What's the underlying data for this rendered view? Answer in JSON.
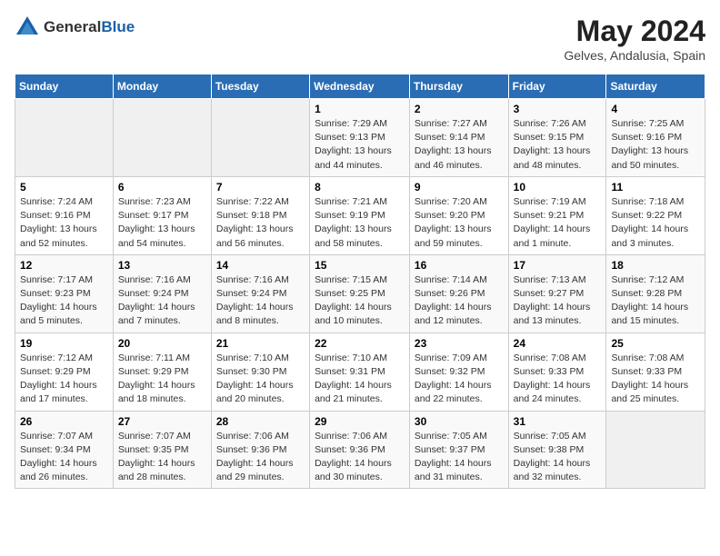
{
  "header": {
    "logo_general": "General",
    "logo_blue": "Blue",
    "month": "May 2024",
    "location": "Gelves, Andalusia, Spain"
  },
  "weekdays": [
    "Sunday",
    "Monday",
    "Tuesday",
    "Wednesday",
    "Thursday",
    "Friday",
    "Saturday"
  ],
  "weeks": [
    [
      {
        "day": "",
        "info": ""
      },
      {
        "day": "",
        "info": ""
      },
      {
        "day": "",
        "info": ""
      },
      {
        "day": "1",
        "info": "Sunrise: 7:29 AM\nSunset: 9:13 PM\nDaylight: 13 hours\nand 44 minutes."
      },
      {
        "day": "2",
        "info": "Sunrise: 7:27 AM\nSunset: 9:14 PM\nDaylight: 13 hours\nand 46 minutes."
      },
      {
        "day": "3",
        "info": "Sunrise: 7:26 AM\nSunset: 9:15 PM\nDaylight: 13 hours\nand 48 minutes."
      },
      {
        "day": "4",
        "info": "Sunrise: 7:25 AM\nSunset: 9:16 PM\nDaylight: 13 hours\nand 50 minutes."
      }
    ],
    [
      {
        "day": "5",
        "info": "Sunrise: 7:24 AM\nSunset: 9:16 PM\nDaylight: 13 hours\nand 52 minutes."
      },
      {
        "day": "6",
        "info": "Sunrise: 7:23 AM\nSunset: 9:17 PM\nDaylight: 13 hours\nand 54 minutes."
      },
      {
        "day": "7",
        "info": "Sunrise: 7:22 AM\nSunset: 9:18 PM\nDaylight: 13 hours\nand 56 minutes."
      },
      {
        "day": "8",
        "info": "Sunrise: 7:21 AM\nSunset: 9:19 PM\nDaylight: 13 hours\nand 58 minutes."
      },
      {
        "day": "9",
        "info": "Sunrise: 7:20 AM\nSunset: 9:20 PM\nDaylight: 13 hours\nand 59 minutes."
      },
      {
        "day": "10",
        "info": "Sunrise: 7:19 AM\nSunset: 9:21 PM\nDaylight: 14 hours\nand 1 minute."
      },
      {
        "day": "11",
        "info": "Sunrise: 7:18 AM\nSunset: 9:22 PM\nDaylight: 14 hours\nand 3 minutes."
      }
    ],
    [
      {
        "day": "12",
        "info": "Sunrise: 7:17 AM\nSunset: 9:23 PM\nDaylight: 14 hours\nand 5 minutes."
      },
      {
        "day": "13",
        "info": "Sunrise: 7:16 AM\nSunset: 9:24 PM\nDaylight: 14 hours\nand 7 minutes."
      },
      {
        "day": "14",
        "info": "Sunrise: 7:16 AM\nSunset: 9:24 PM\nDaylight: 14 hours\nand 8 minutes."
      },
      {
        "day": "15",
        "info": "Sunrise: 7:15 AM\nSunset: 9:25 PM\nDaylight: 14 hours\nand 10 minutes."
      },
      {
        "day": "16",
        "info": "Sunrise: 7:14 AM\nSunset: 9:26 PM\nDaylight: 14 hours\nand 12 minutes."
      },
      {
        "day": "17",
        "info": "Sunrise: 7:13 AM\nSunset: 9:27 PM\nDaylight: 14 hours\nand 13 minutes."
      },
      {
        "day": "18",
        "info": "Sunrise: 7:12 AM\nSunset: 9:28 PM\nDaylight: 14 hours\nand 15 minutes."
      }
    ],
    [
      {
        "day": "19",
        "info": "Sunrise: 7:12 AM\nSunset: 9:29 PM\nDaylight: 14 hours\nand 17 minutes."
      },
      {
        "day": "20",
        "info": "Sunrise: 7:11 AM\nSunset: 9:29 PM\nDaylight: 14 hours\nand 18 minutes."
      },
      {
        "day": "21",
        "info": "Sunrise: 7:10 AM\nSunset: 9:30 PM\nDaylight: 14 hours\nand 20 minutes."
      },
      {
        "day": "22",
        "info": "Sunrise: 7:10 AM\nSunset: 9:31 PM\nDaylight: 14 hours\nand 21 minutes."
      },
      {
        "day": "23",
        "info": "Sunrise: 7:09 AM\nSunset: 9:32 PM\nDaylight: 14 hours\nand 22 minutes."
      },
      {
        "day": "24",
        "info": "Sunrise: 7:08 AM\nSunset: 9:33 PM\nDaylight: 14 hours\nand 24 minutes."
      },
      {
        "day": "25",
        "info": "Sunrise: 7:08 AM\nSunset: 9:33 PM\nDaylight: 14 hours\nand 25 minutes."
      }
    ],
    [
      {
        "day": "26",
        "info": "Sunrise: 7:07 AM\nSunset: 9:34 PM\nDaylight: 14 hours\nand 26 minutes."
      },
      {
        "day": "27",
        "info": "Sunrise: 7:07 AM\nSunset: 9:35 PM\nDaylight: 14 hours\nand 28 minutes."
      },
      {
        "day": "28",
        "info": "Sunrise: 7:06 AM\nSunset: 9:36 PM\nDaylight: 14 hours\nand 29 minutes."
      },
      {
        "day": "29",
        "info": "Sunrise: 7:06 AM\nSunset: 9:36 PM\nDaylight: 14 hours\nand 30 minutes."
      },
      {
        "day": "30",
        "info": "Sunrise: 7:05 AM\nSunset: 9:37 PM\nDaylight: 14 hours\nand 31 minutes."
      },
      {
        "day": "31",
        "info": "Sunrise: 7:05 AM\nSunset: 9:38 PM\nDaylight: 14 hours\nand 32 minutes."
      },
      {
        "day": "",
        "info": ""
      }
    ]
  ]
}
